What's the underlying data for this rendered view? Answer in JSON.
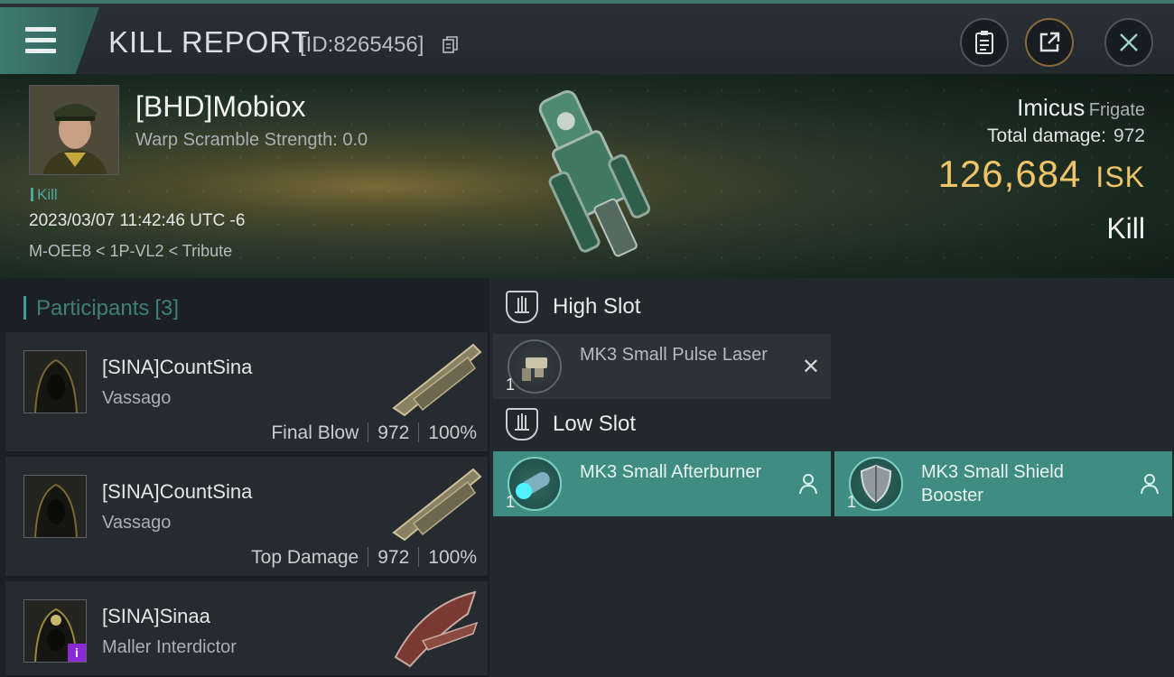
{
  "header": {
    "title": "KILL REPORT",
    "report_id": "[ID:8265456]"
  },
  "victim": {
    "name": "[BHD]Mobiox",
    "warp_scramble": "Warp Scramble Strength: 0.0",
    "kill_tag": "Kill",
    "datetime": "2023/03/07 11:42:46 UTC -6",
    "location": "M-OEE8 < 1P-VL2 < Tribute",
    "ship_name": "Imicus",
    "ship_class": "Frigate",
    "total_damage_label": "Total damage:",
    "total_damage_value": "972",
    "isk_value": "126,684",
    "isk_unit": "ISK",
    "result": "Kill"
  },
  "participants": {
    "label": "Participants",
    "count": "[3]",
    "rows": [
      {
        "name": "[SINA]CountSina",
        "ship": "Vassago",
        "role": "Final Blow",
        "damage": "972",
        "percent": "100%"
      },
      {
        "name": "[SINA]CountSina",
        "ship": "Vassago",
        "role": "Top Damage",
        "damage": "972",
        "percent": "100%"
      },
      {
        "name": "[SINA]Sinaa",
        "ship": "Maller Interdictor",
        "badge": "i"
      }
    ]
  },
  "fitting": {
    "high_slot": {
      "label": "High Slot",
      "modules": [
        {
          "name": "MK3 Small Pulse Laser",
          "qty": "1",
          "status": "destroyed"
        }
      ]
    },
    "low_slot": {
      "label": "Low Slot",
      "modules": [
        {
          "name": "MK3 Small Afterburner",
          "qty": "1",
          "status": "dropped"
        },
        {
          "name": "MK3 Small Shield Booster",
          "qty": "1",
          "status": "dropped"
        }
      ]
    }
  },
  "colors": {
    "accent": "#3f8d82",
    "isk": "#f1c46a",
    "badge": "#8a2ad6"
  },
  "icons": [
    "menu-icon",
    "copy-icon",
    "clipboard-icon",
    "share-icon",
    "close-icon",
    "slot-icon",
    "remove-icon",
    "person-icon"
  ]
}
